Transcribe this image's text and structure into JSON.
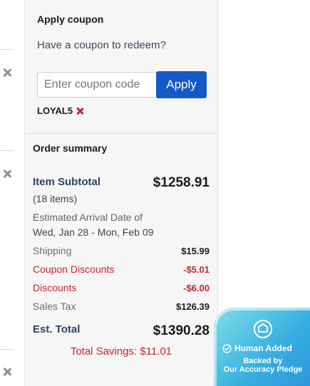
{
  "coupon": {
    "title": "Apply coupon",
    "prompt": "Have a coupon to redeem?",
    "input_placeholder": "Enter coupon code",
    "input_value": "",
    "apply_label": "Apply",
    "applied_code": "LOYAL5"
  },
  "summary": {
    "title": "Order summary",
    "subtotal_label": "Item Subtotal",
    "subtotal_count": "(18 items)",
    "subtotal_value": "$1258.91",
    "arrival_label": "Estimated Arrival Date of",
    "arrival_value": "Wed, Jan 28 - Mon, Feb 09",
    "rows": [
      {
        "label": "Shipping",
        "value": "$15.99"
      },
      {
        "label": "Coupon Discounts",
        "value": "-$5.01"
      },
      {
        "label": "Discounts",
        "value": "-$6.00"
      },
      {
        "label": "Sales Tax",
        "value": "$126.39"
      }
    ],
    "total_label": "Est. Total",
    "total_value": "$1390.28",
    "savings": "Total Savings: $11.01"
  },
  "badge": {
    "title": "Human Added",
    "line1": "Backed by",
    "line2": "Our Accuracy Pledge"
  },
  "icons": {
    "remove_item": "close-icon",
    "remove_coupon": "close-icon",
    "badge_shield": "shield-icon",
    "badge_check": "check-circle-icon"
  },
  "colors": {
    "primary_button": "#1459c7",
    "discount_red": "#cc1f2d",
    "heading_navy": "#2e4266",
    "badge_teal": "#36aee0"
  }
}
